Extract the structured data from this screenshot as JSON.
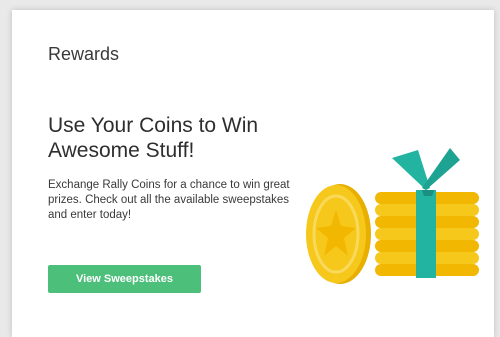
{
  "card": {
    "title": "Rewards",
    "headline": "Use Your Coins to Win Awesome Stuff!",
    "description": "Exchange Rally Coins for a chance to win great prizes. Check out all the available sweepstakes and enter today!",
    "cta_label": "View Sweepstakes"
  },
  "colors": {
    "background": "#e9e9e9",
    "card": "#ffffff",
    "button": "#4cbf7a",
    "coin": "#f7c81c",
    "ribbon": "#22b3a1"
  },
  "illustration": {
    "icon": "gift-coins-icon"
  }
}
